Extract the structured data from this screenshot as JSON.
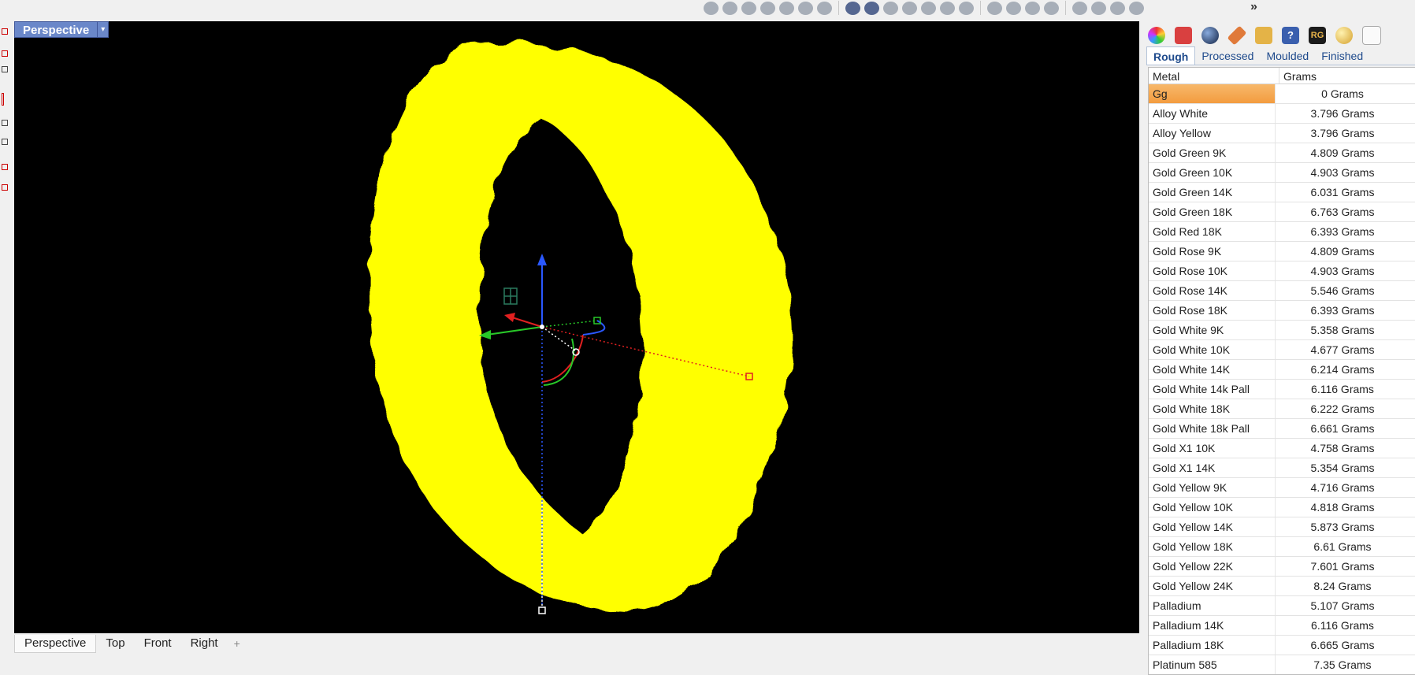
{
  "viewport": {
    "label": "Perspective",
    "dropdown_arrow": "▾"
  },
  "bottom_tabs": [
    "Perspective",
    "Top",
    "Front",
    "Right"
  ],
  "bottom_add": "+",
  "toolbar_overflow": "»",
  "panel": {
    "tabs": [
      "Rough",
      "Processed",
      "Moulded",
      "Finished"
    ],
    "active_tab": "Rough",
    "icon_names": [
      "color-wheel-icon",
      "layers-icon",
      "render-sphere-icon",
      "pencil-icon",
      "folder-icon",
      "help-icon",
      "rg-logo-icon",
      "material-ball-icon",
      "cup-icon"
    ],
    "columns": [
      "Metal",
      "Grams"
    ],
    "rows": [
      {
        "metal": "Gg",
        "grams": "0 Grams"
      },
      {
        "metal": "Alloy White",
        "grams": "3.796 Grams"
      },
      {
        "metal": "Alloy Yellow",
        "grams": "3.796 Grams"
      },
      {
        "metal": "Gold Green 9K",
        "grams": "4.809 Grams"
      },
      {
        "metal": "Gold Green 10K",
        "grams": "4.903 Grams"
      },
      {
        "metal": "Gold Green 14K",
        "grams": "6.031 Grams"
      },
      {
        "metal": "Gold Green 18K",
        "grams": "6.763 Grams"
      },
      {
        "metal": "Gold Red 18K",
        "grams": "6.393 Grams"
      },
      {
        "metal": "Gold Rose 9K",
        "grams": "4.809 Grams"
      },
      {
        "metal": "Gold Rose 10K",
        "grams": "4.903 Grams"
      },
      {
        "metal": "Gold Rose 14K",
        "grams": "5.546 Grams"
      },
      {
        "metal": "Gold Rose 18K",
        "grams": "6.393 Grams"
      },
      {
        "metal": "Gold White 9K",
        "grams": "5.358 Grams"
      },
      {
        "metal": "Gold White 10K",
        "grams": "4.677 Grams"
      },
      {
        "metal": "Gold White 14K",
        "grams": "6.214 Grams"
      },
      {
        "metal": "Gold White 14k Pall",
        "grams": "6.116 Grams"
      },
      {
        "metal": "Gold White 18K",
        "grams": "6.222 Grams"
      },
      {
        "metal": "Gold White 18k Pall",
        "grams": "6.661 Grams"
      },
      {
        "metal": "Gold X1 10K",
        "grams": "4.758 Grams"
      },
      {
        "metal": "Gold X1 14K",
        "grams": "5.354 Grams"
      },
      {
        "metal": "Gold Yellow 9K",
        "grams": "4.716 Grams"
      },
      {
        "metal": "Gold Yellow 10K",
        "grams": "4.818 Grams"
      },
      {
        "metal": "Gold Yellow 14K",
        "grams": "5.873 Grams"
      },
      {
        "metal": "Gold Yellow 18K",
        "grams": "6.61 Grams"
      },
      {
        "metal": "Gold Yellow 22K",
        "grams": "7.601 Grams"
      },
      {
        "metal": "Gold Yellow 24K",
        "grams": "8.24 Grams"
      },
      {
        "metal": "Palladium",
        "grams": "5.107 Grams"
      },
      {
        "metal": "Palladium 14K",
        "grams": "6.116 Grams"
      },
      {
        "metal": "Palladium 18K",
        "grams": "6.665 Grams"
      },
      {
        "metal": "Platinum 585",
        "grams": "7.35 Grams"
      }
    ],
    "selected_row": 0
  },
  "colors": {
    "viewport_bg": "#000000",
    "ring": "#ffff00",
    "viewport_label_bg": "#6a87c9",
    "selected_row": "#f39c3f"
  }
}
